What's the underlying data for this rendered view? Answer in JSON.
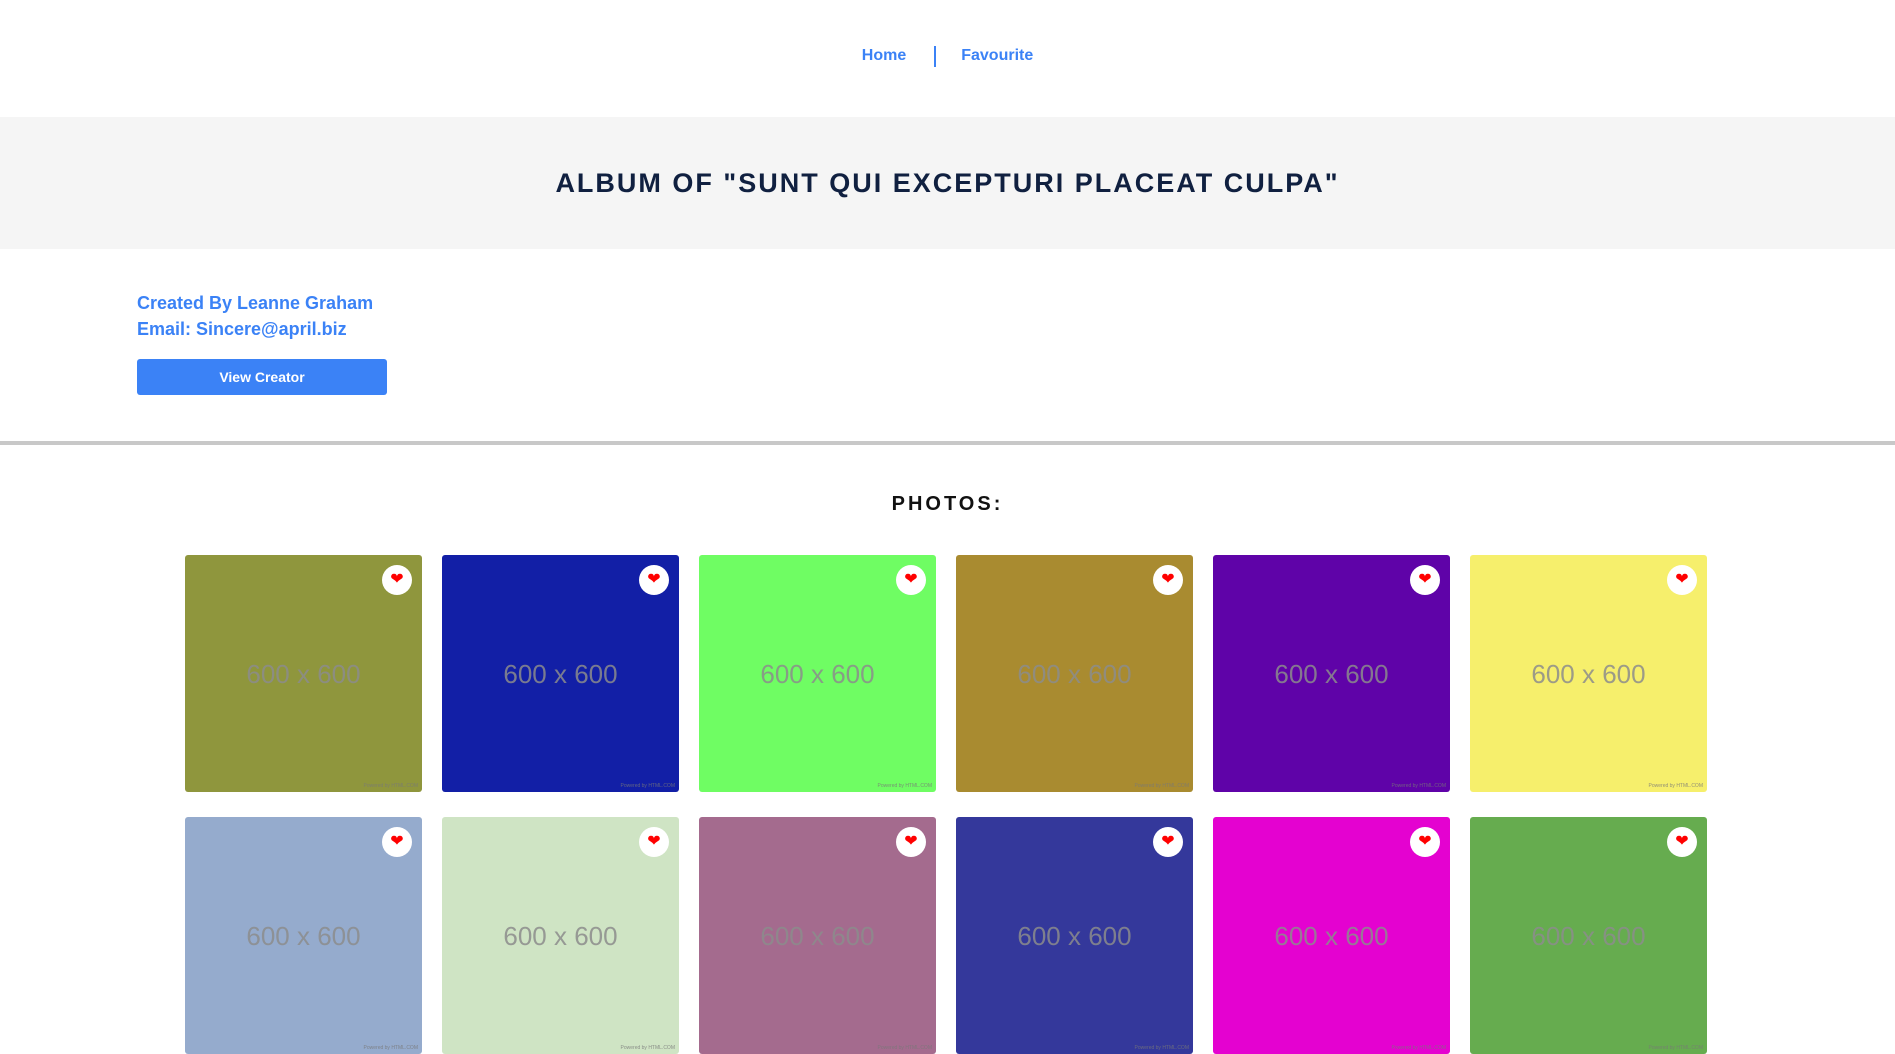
{
  "nav": {
    "home": "Home",
    "favourite": "Favourite"
  },
  "album": {
    "title": "ALBUM OF \"SUNT QUI EXCEPTURI PLACEAT CULPA\""
  },
  "creator": {
    "created_by": "Created By Leanne Graham",
    "email": "Email: Sincere@april.biz",
    "button_label": "View Creator"
  },
  "photos": {
    "heading": "PHOTOS:",
    "placeholder": "600 x 600",
    "powered_by": "Powered by HTML.COM",
    "fav_icon": "heart-icon",
    "items": [
      {
        "color": "#8f963d"
      },
      {
        "color": "#121fa6"
      },
      {
        "color": "#6ffd63"
      },
      {
        "color": "#a98b30"
      },
      {
        "color": "#5f03a8"
      },
      {
        "color": "#f6ef6c"
      },
      {
        "color": "#95abcd"
      },
      {
        "color": "#cfe4c4"
      },
      {
        "color": "#a46b8e"
      },
      {
        "color": "#34389b"
      },
      {
        "color": "#e402d0"
      },
      {
        "color": "#66ac4f"
      }
    ]
  }
}
